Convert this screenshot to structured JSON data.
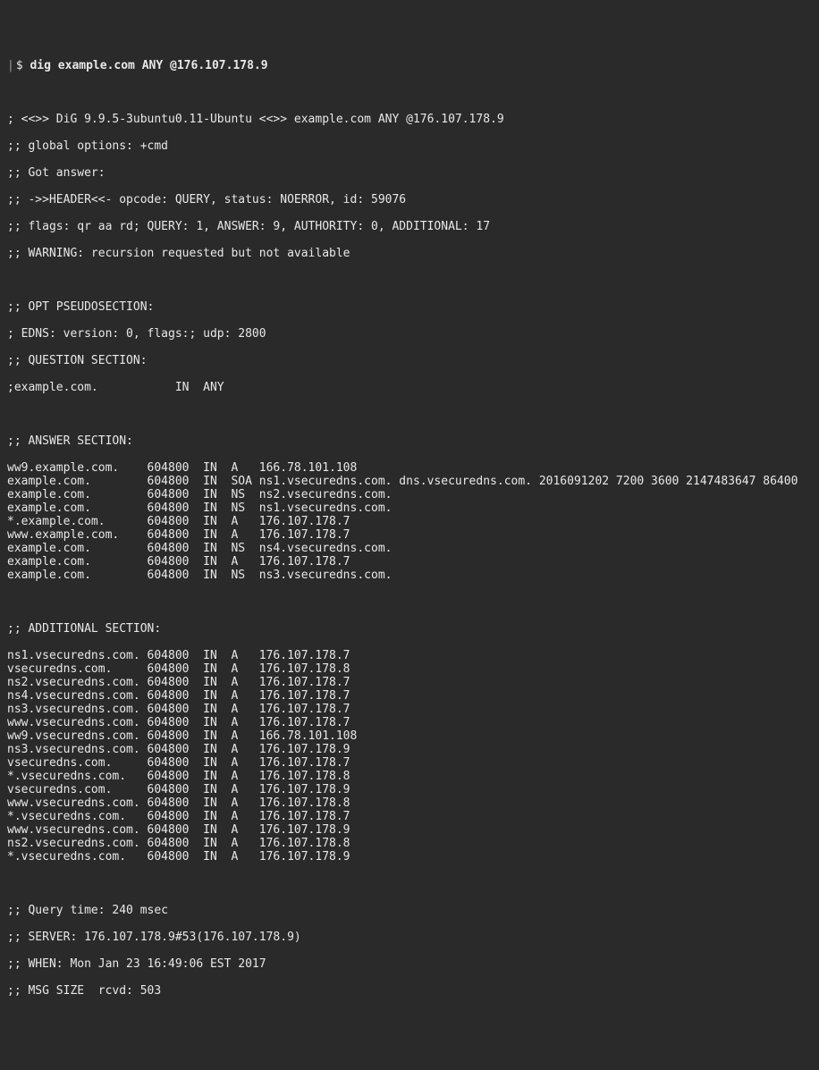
{
  "prompt": "$ ",
  "command": "dig example.com ANY @176.107.178.9",
  "banner": "; <<>> DiG 9.9.5-3ubuntu0.11-Ubuntu <<>> example.com ANY @176.107.178.9",
  "global_options": ";; global options: +cmd",
  "got_answer": ";; Got answer:",
  "header": ";; ->>HEADER<<- opcode: QUERY, status: NOERROR, id: 59076",
  "flags": ";; flags: qr aa rd; QUERY: 1, ANSWER: 9, AUTHORITY: 0, ADDITIONAL: 17",
  "warning": ";; WARNING: recursion requested but not available",
  "opt_header": ";; OPT PSEUDOSECTION:",
  "edns": "; EDNS: version: 0, flags:; udp: 2800",
  "question_header": ";; QUESTION SECTION:",
  "question_row": ";example.com.           IN  ANY",
  "answer_header": ";; ANSWER SECTION:",
  "answers": [
    "ww9.example.com.    604800  IN  A   166.78.101.108",
    "example.com.        604800  IN  SOA ns1.vsecuredns.com. dns.vsecuredns.com. 2016091202 7200 3600 2147483647 86400",
    "example.com.        604800  IN  NS  ns2.vsecuredns.com.",
    "example.com.        604800  IN  NS  ns1.vsecuredns.com.",
    "*.example.com.      604800  IN  A   176.107.178.7",
    "www.example.com.    604800  IN  A   176.107.178.7",
    "example.com.        604800  IN  NS  ns4.vsecuredns.com.",
    "example.com.        604800  IN  A   176.107.178.7",
    "example.com.        604800  IN  NS  ns3.vsecuredns.com."
  ],
  "additional_header": ";; ADDITIONAL SECTION:",
  "additional": [
    "ns1.vsecuredns.com. 604800  IN  A   176.107.178.7",
    "vsecuredns.com.     604800  IN  A   176.107.178.8",
    "ns2.vsecuredns.com. 604800  IN  A   176.107.178.7",
    "ns4.vsecuredns.com. 604800  IN  A   176.107.178.7",
    "ns3.vsecuredns.com. 604800  IN  A   176.107.178.7",
    "www.vsecuredns.com. 604800  IN  A   176.107.178.7",
    "ww9.vsecuredns.com. 604800  IN  A   166.78.101.108",
    "ns3.vsecuredns.com. 604800  IN  A   176.107.178.9",
    "vsecuredns.com.     604800  IN  A   176.107.178.7",
    "*.vsecuredns.com.   604800  IN  A   176.107.178.8",
    "vsecuredns.com.     604800  IN  A   176.107.178.9",
    "www.vsecuredns.com. 604800  IN  A   176.107.178.8",
    "*.vsecuredns.com.   604800  IN  A   176.107.178.7",
    "www.vsecuredns.com. 604800  IN  A   176.107.178.9",
    "ns2.vsecuredns.com. 604800  IN  A   176.107.178.8",
    "*.vsecuredns.com.   604800  IN  A   176.107.178.9"
  ],
  "query_time": ";; Query time: 240 msec",
  "server": ";; SERVER: 176.107.178.9#53(176.107.178.9)",
  "when": ";; WHEN: Mon Jan 23 16:49:06 EST 2017",
  "msg_size": ";; MSG SIZE  rcvd: 503"
}
